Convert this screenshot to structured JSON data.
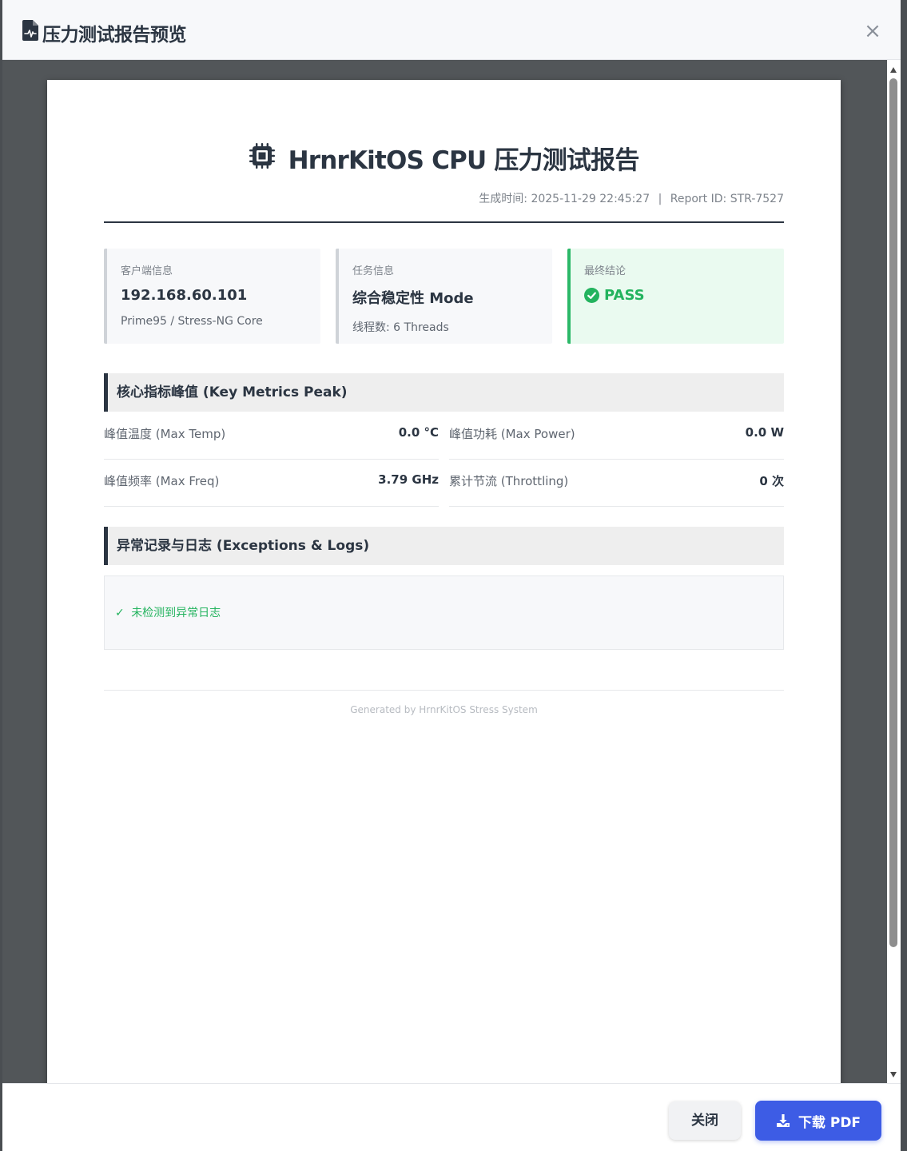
{
  "modal": {
    "title": "压力测试报告预览",
    "close_symbol": "×"
  },
  "report": {
    "title": "HrnrKitOS CPU 压力测试报告",
    "generated_label": "生成时间:",
    "generated_time": "2025-11-29 22:45:27",
    "separator": "|",
    "report_id_label": "Report ID:",
    "report_id": "STR-7527"
  },
  "cards": {
    "client": {
      "label": "客户端信息",
      "value": "192.168.60.101",
      "sub": "Prime95 / Stress-NG Core"
    },
    "task": {
      "label": "任务信息",
      "value": "综合稳定性 Mode",
      "sub": "线程数: 6 Threads"
    },
    "result": {
      "label": "最终结论",
      "value": "PASS"
    }
  },
  "metrics": {
    "heading": "核心指标峰值 (Key Metrics Peak)",
    "max_temp": {
      "label": "峰值温度 (Max Temp)",
      "value": "0.0 °C"
    },
    "max_power": {
      "label": "峰值功耗 (Max Power)",
      "value": "0.0 W"
    },
    "max_freq": {
      "label": "峰值频率 (Max Freq)",
      "value": "3.79 GHz"
    },
    "throttling": {
      "label": "累计节流 (Throttling)",
      "value": "0 次"
    }
  },
  "logs": {
    "heading": "异常记录与日志 (Exceptions & Logs)",
    "check_symbol": "✓",
    "message": "未检测到异常日志"
  },
  "footer": {
    "text": "Generated by HrnrKitOS Stress System",
    "close_label": "关闭",
    "download_label": "下载 PDF"
  },
  "icons": {
    "header": "file-waveform-icon",
    "title": "cpu-chip-icon",
    "pass": "check-circle-icon",
    "download": "download-icon"
  },
  "colors": {
    "primary_text": "#2b3542",
    "pass_green": "#23b35e",
    "download_blue": "#3d5ce5",
    "viewer_bg": "#525659"
  }
}
